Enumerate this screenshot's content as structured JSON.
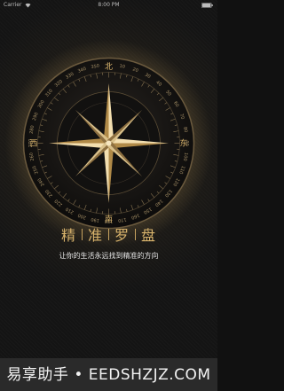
{
  "status_bar": {
    "carrier": "Carrier",
    "time": "8:00 PM"
  },
  "compass": {
    "directions": {
      "north": "北",
      "east": "东",
      "south": "南",
      "west": "西"
    },
    "degree_labels": [
      "0",
      "10",
      "20",
      "30",
      "40",
      "50",
      "60",
      "70",
      "80",
      "90",
      "100",
      "110",
      "120",
      "130",
      "140",
      "150",
      "160",
      "170",
      "180",
      "190",
      "200",
      "210",
      "220",
      "230",
      "240",
      "250",
      "260",
      "270",
      "280",
      "290",
      "300",
      "310",
      "320",
      "330",
      "340",
      "350"
    ],
    "accent_color": "#d9b46c"
  },
  "app": {
    "title_chars": [
      "精",
      "准",
      "罗",
      "盘"
    ],
    "subtitle": "让你的生活永远找到精准的方向"
  },
  "watermark": {
    "text": "易享助手 • EEDSHZJZ.COM"
  }
}
